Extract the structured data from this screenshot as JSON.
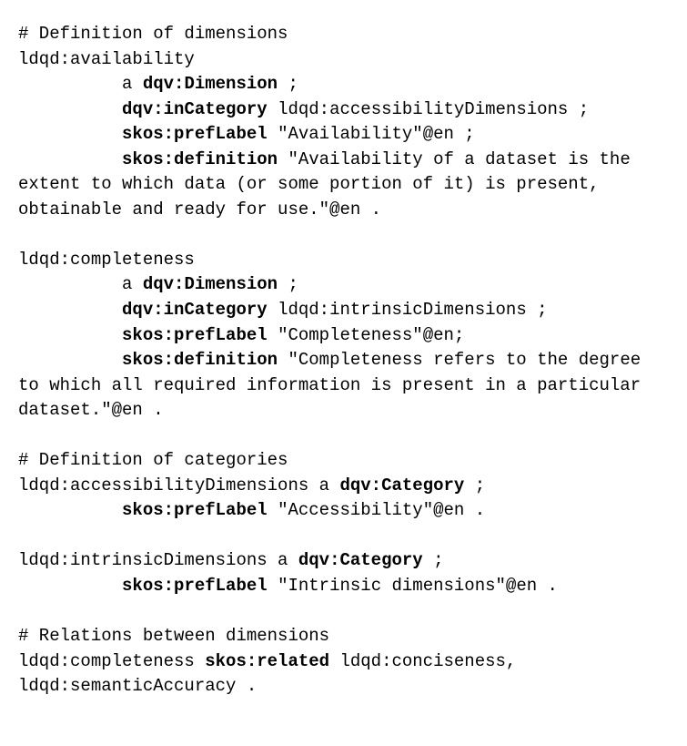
{
  "lines": [
    {
      "segments": [
        {
          "text": "# Definition of dimensions",
          "bold": false
        }
      ]
    },
    {
      "segments": [
        {
          "text": "ldqd:availability",
          "bold": false
        }
      ]
    },
    {
      "segments": [
        {
          "text": "          a ",
          "bold": false
        },
        {
          "text": "dqv:Dimension",
          "bold": true
        },
        {
          "text": " ;",
          "bold": false
        }
      ]
    },
    {
      "segments": [
        {
          "text": "          ",
          "bold": false
        },
        {
          "text": "dqv:inCategory",
          "bold": true
        },
        {
          "text": " ldqd:accessibilityDimensions ;",
          "bold": false
        }
      ]
    },
    {
      "segments": [
        {
          "text": "          ",
          "bold": false
        },
        {
          "text": "skos:prefLabel",
          "bold": true
        },
        {
          "text": " \"Availability\"@en ;",
          "bold": false
        }
      ]
    },
    {
      "segments": [
        {
          "text": "          ",
          "bold": false
        },
        {
          "text": "skos:definition",
          "bold": true
        },
        {
          "text": " \"Availability of a dataset is the extent to which data (or some portion of it) is present, obtainable and ready for use.\"@en .",
          "bold": false
        }
      ]
    },
    {
      "segments": [
        {
          "text": "",
          "bold": false
        }
      ]
    },
    {
      "segments": [
        {
          "text": "ldqd:completeness",
          "bold": false
        }
      ]
    },
    {
      "segments": [
        {
          "text": "          a ",
          "bold": false
        },
        {
          "text": "dqv:Dimension",
          "bold": true
        },
        {
          "text": " ;",
          "bold": false
        }
      ]
    },
    {
      "segments": [
        {
          "text": "          ",
          "bold": false
        },
        {
          "text": "dqv:inCategory",
          "bold": true
        },
        {
          "text": " ldqd:intrinsicDimensions ;",
          "bold": false
        }
      ]
    },
    {
      "segments": [
        {
          "text": "          ",
          "bold": false
        },
        {
          "text": "skos:prefLabel",
          "bold": true
        },
        {
          "text": " \"Completeness\"@en;",
          "bold": false
        }
      ]
    },
    {
      "segments": [
        {
          "text": "          ",
          "bold": false
        },
        {
          "text": "skos:definition",
          "bold": true
        },
        {
          "text": " \"Completeness refers to the degree to which all required information is present in a particular dataset.\"@en .",
          "bold": false
        }
      ]
    },
    {
      "segments": [
        {
          "text": "",
          "bold": false
        }
      ]
    },
    {
      "segments": [
        {
          "text": "# Definition of categories",
          "bold": false
        }
      ]
    },
    {
      "segments": [
        {
          "text": "ldqd:accessibilityDimensions a ",
          "bold": false
        },
        {
          "text": "dqv:Category",
          "bold": true
        },
        {
          "text": " ;",
          "bold": false
        }
      ]
    },
    {
      "segments": [
        {
          "text": "          ",
          "bold": false
        },
        {
          "text": "skos:prefLabel",
          "bold": true
        },
        {
          "text": " \"Accessibility\"@en .",
          "bold": false
        }
      ]
    },
    {
      "segments": [
        {
          "text": "",
          "bold": false
        }
      ]
    },
    {
      "segments": [
        {
          "text": "ldqd:intrinsicDimensions a ",
          "bold": false
        },
        {
          "text": "dqv:Category",
          "bold": true
        },
        {
          "text": " ;",
          "bold": false
        }
      ]
    },
    {
      "segments": [
        {
          "text": "          ",
          "bold": false
        },
        {
          "text": "skos:prefLabel",
          "bold": true
        },
        {
          "text": " \"Intrinsic dimensions\"@en .",
          "bold": false
        }
      ]
    },
    {
      "segments": [
        {
          "text": "",
          "bold": false
        }
      ]
    },
    {
      "segments": [
        {
          "text": "# Relations between dimensions",
          "bold": false
        }
      ]
    },
    {
      "segments": [
        {
          "text": "ldqd:completeness ",
          "bold": false
        },
        {
          "text": "skos:related",
          "bold": true
        },
        {
          "text": " ldqd:conciseness, ldqd:semanticAccuracy .",
          "bold": false
        }
      ]
    }
  ]
}
